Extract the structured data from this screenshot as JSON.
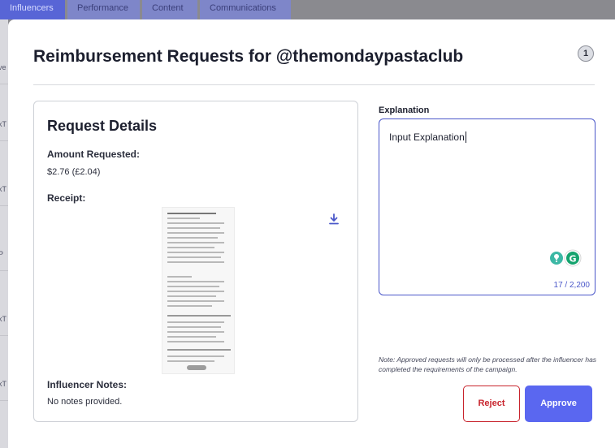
{
  "tabs": [
    {
      "label": "Influencers"
    },
    {
      "label": "Performance"
    },
    {
      "label": "Content"
    },
    {
      "label": "Communications"
    }
  ],
  "background_rows": [
    "ve",
    "kT",
    "kT",
    "P",
    "kT",
    "kT"
  ],
  "modal": {
    "title": "Reimbursement Requests for @themondaypastaclub",
    "badge": "1"
  },
  "request_details": {
    "heading": "Request Details",
    "amount_label": "Amount Requested:",
    "amount_value": "$2.76 (£2.04)",
    "receipt_label": "Receipt:",
    "notes_label": "Influencer Notes:",
    "notes_value": "No notes provided."
  },
  "explanation": {
    "label": "Explanation",
    "value": "Input Explanation",
    "counter": "17 / 2,200"
  },
  "note": "Note: Approved requests will only be processed after the influencer has completed the requirements of the campaign.",
  "actions": {
    "reject_label": "Reject",
    "approve_label": "Approve"
  },
  "colors": {
    "accent": "#5a67f0",
    "reject": "#c8242d",
    "tab_active": "#5865d6"
  }
}
